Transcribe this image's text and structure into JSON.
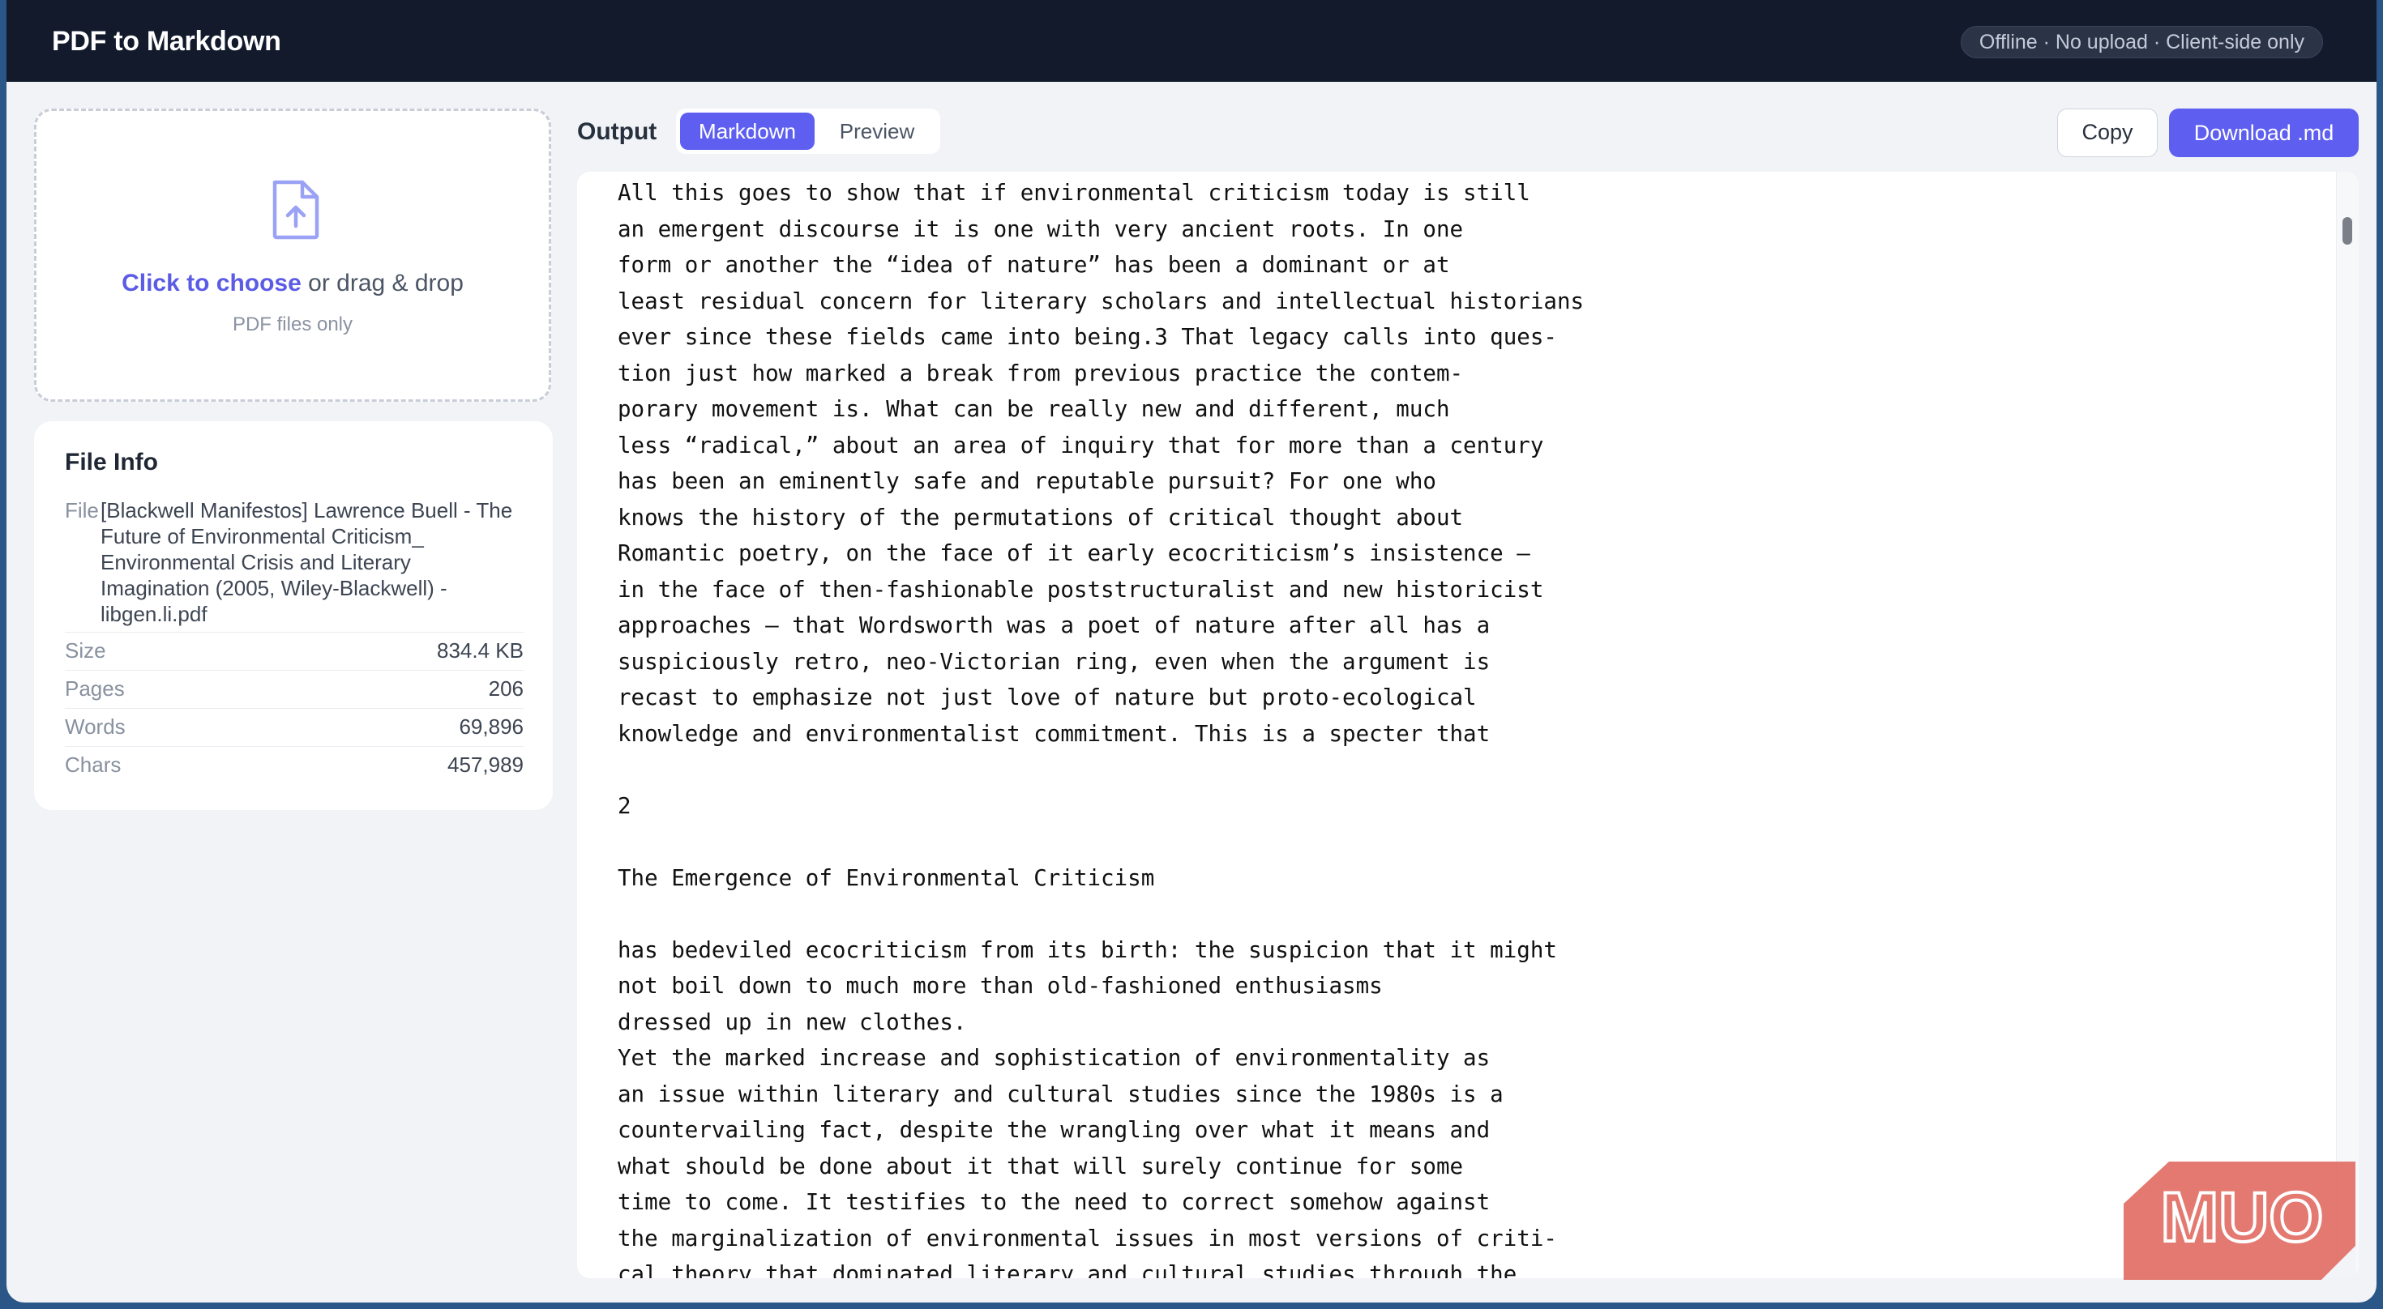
{
  "app": {
    "title": "PDF to Markdown",
    "status": "Offline · No upload · Client-side only"
  },
  "dropzone": {
    "link_text": "Click to choose",
    "rest_text": " or drag & drop",
    "sub": "PDF files only",
    "icon": "file-upload-icon"
  },
  "file_info": {
    "title": "File Info",
    "file_label": "File",
    "file_name": "[Blackwell Manifestos] Lawrence Buell - The Future of Environmental Criticism_ Environmental Crisis and Literary Imagination (2005, Wiley-Blackwell) - libgen.li.pdf",
    "rows": [
      {
        "label": "Size",
        "value": "834.4 KB"
      },
      {
        "label": "Pages",
        "value": "206"
      },
      {
        "label": "Words",
        "value": "69,896"
      },
      {
        "label": "Chars",
        "value": "457,989"
      }
    ]
  },
  "output": {
    "label": "Output",
    "tabs": [
      {
        "label": "Markdown",
        "active": true
      },
      {
        "label": "Preview",
        "active": false
      }
    ],
    "copy_label": "Copy",
    "download_label": "Download .md",
    "text": "All this goes to show that if environmental criticism today is still\nan emergent discourse it is one with very ancient roots. In one\nform or another the “idea of nature” has been a dominant or at\nleast residual concern for literary scholars and intellectual historians\never since these fields came into being.3 That legacy calls into ques-\ntion just how marked a break from previous practice the contem-\nporary movement is. What can be really new and different, much\nless “radical,” about an area of inquiry that for more than a century\nhas been an eminently safe and reputable pursuit? For one who\nknows the history of the permutations of critical thought about\nRomantic poetry, on the face of it early ecocriticism’s insistence –\nin the face of then-fashionable poststructuralist and new historicist\napproaches – that Wordsworth was a poet of nature after all has a\nsuspiciously retro, neo-Victorian ring, even when the argument is\nrecast to emphasize not just love of nature but proto-ecological\nknowledge and environmentalist commitment. This is a specter that\n\n2\n\nThe Emergence of Environmental Criticism\n\nhas bedeviled ecocriticism from its birth: the suspicion that it might\nnot boil down to much more than old-fashioned enthusiasms\ndressed up in new clothes.\nYet the marked increase and sophistication of environmentality as\nan issue within literary and cultural studies since the 1980s is a\ncountervailing fact, despite the wrangling over what it means and\nwhat should be done about it that will surely continue for some\ntime to come. It testifies to the need to correct somehow against\nthe marginalization of environmental issues in most versions of criti-\ncal theory that dominated literary and cultural studies through the"
  },
  "watermark": {
    "text": "MUO",
    "color": "#e06a60"
  },
  "colors": {
    "accent": "#5e5ff0",
    "topbar": "#121a2c",
    "background": "#f1f3f7"
  }
}
